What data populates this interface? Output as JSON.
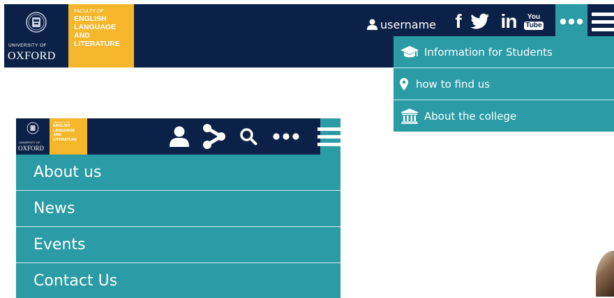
{
  "colors": {
    "navy": "#0c2147",
    "teal": "#2b9ba5",
    "gold": "#f4b62b"
  },
  "brand": {
    "university_small": "UNIVERSITY OF",
    "university_name": "OXFORD",
    "faculty_of": "FACULTY OF",
    "faculty_lines": [
      "ENGLISH",
      "LANGUAGE",
      "AND",
      "LITERATURE"
    ]
  },
  "header": {
    "user_label": "username",
    "social": [
      {
        "icon": "facebook-icon",
        "glyph": "f"
      },
      {
        "icon": "twitter-icon",
        "glyph": "🐦"
      },
      {
        "icon": "linkedin-icon",
        "glyph": "in"
      },
      {
        "icon": "youtube-icon",
        "top": "You",
        "bottom": "Tube"
      }
    ],
    "more_icon": "more-icon",
    "menu_icon": "hamburger-icon"
  },
  "dropdown": {
    "items": [
      {
        "icon": "graduation-cap-icon",
        "label": "Information for Students"
      },
      {
        "icon": "map-pin-icon",
        "label": "how to find us"
      },
      {
        "icon": "institution-icon",
        "label": "About the college"
      }
    ]
  },
  "small_header": {
    "icons": [
      "user-icon",
      "share-icon",
      "search-icon",
      "more-icon",
      "hamburger-icon"
    ]
  },
  "main_menu": {
    "items": [
      {
        "label": "About us"
      },
      {
        "label": "News"
      },
      {
        "label": "Events"
      },
      {
        "label": "Contact Us"
      }
    ]
  }
}
